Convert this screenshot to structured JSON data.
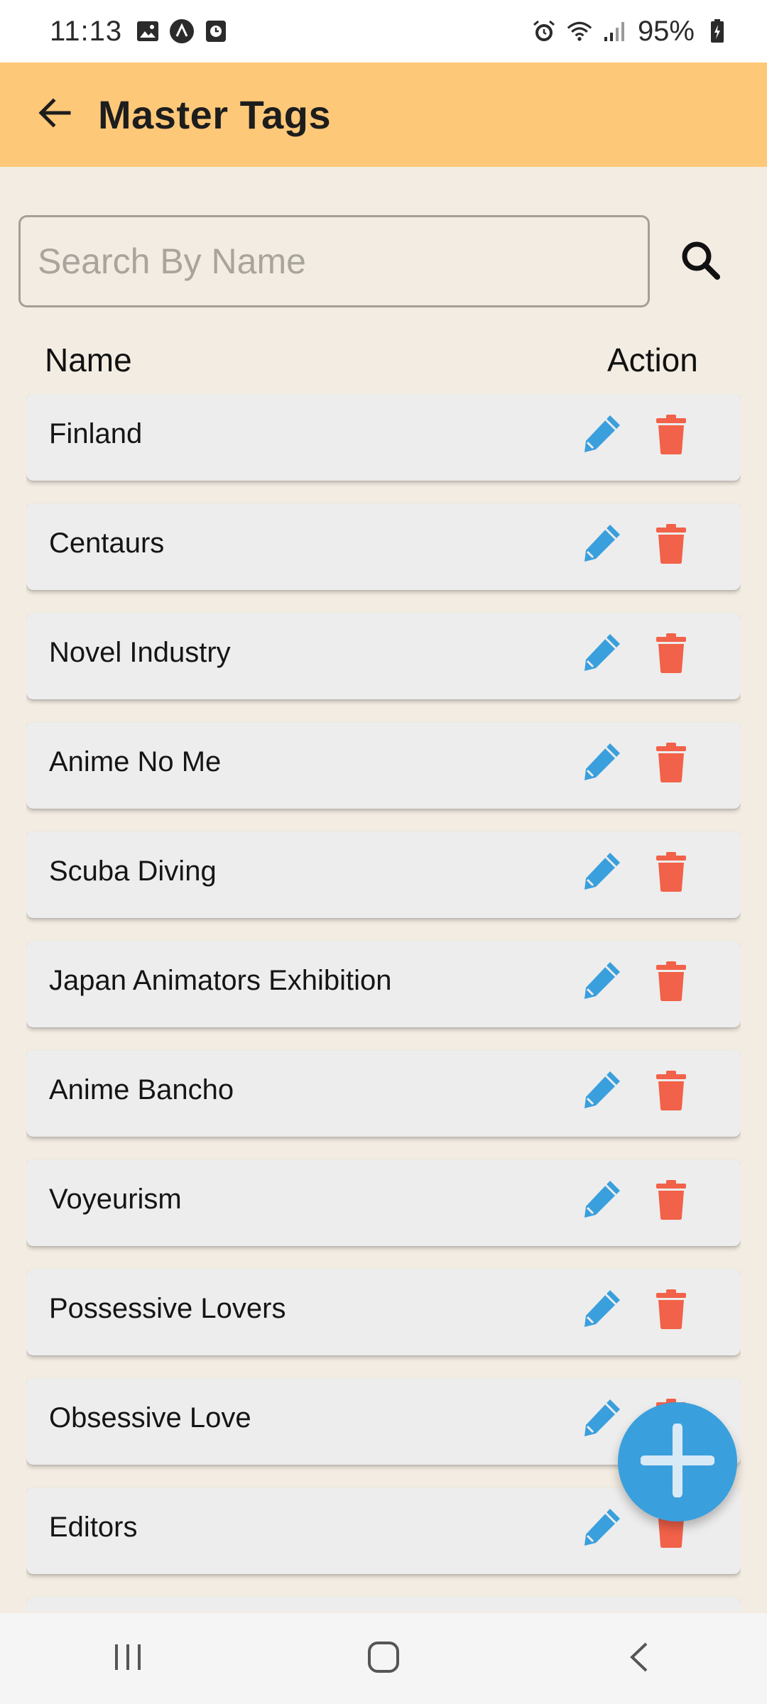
{
  "status_bar": {
    "time": "11:13",
    "battery": "95%",
    "left_icons": [
      "image-icon",
      "navigation-app-icon",
      "clock-app-icon"
    ],
    "right_icons": [
      "alarm-icon",
      "wifi-icon",
      "signal-icon",
      "battery-charging-icon"
    ]
  },
  "app_bar": {
    "title": "Master Tags",
    "back_icon": "arrow-left-icon",
    "background": "#fec879"
  },
  "search": {
    "placeholder": "Search By Name",
    "value": "",
    "icon": "search-icon"
  },
  "table": {
    "header_name": "Name",
    "header_action": "Action",
    "rows": [
      {
        "name": "Finland"
      },
      {
        "name": "Centaurs"
      },
      {
        "name": "Novel Industry"
      },
      {
        "name": "Anime No Me"
      },
      {
        "name": "Scuba Diving"
      },
      {
        "name": "Japan Animators Exhibition"
      },
      {
        "name": "Anime Bancho"
      },
      {
        "name": "Voyeurism"
      },
      {
        "name": "Possessive Lovers"
      },
      {
        "name": "Obsessive Love"
      },
      {
        "name": "Editors"
      },
      {
        "name": ""
      }
    ],
    "edit_icon": "pencil-icon",
    "delete_icon": "trash-icon"
  },
  "fab": {
    "icon": "plus-icon"
  },
  "colors": {
    "accent_blue": "#3a9fdd",
    "delete_red": "#f26149",
    "page_bg": "#f3ece2",
    "row_bg": "#ededed"
  },
  "nav_bar": {
    "buttons": [
      "recents-icon",
      "home-icon",
      "back-icon"
    ]
  }
}
